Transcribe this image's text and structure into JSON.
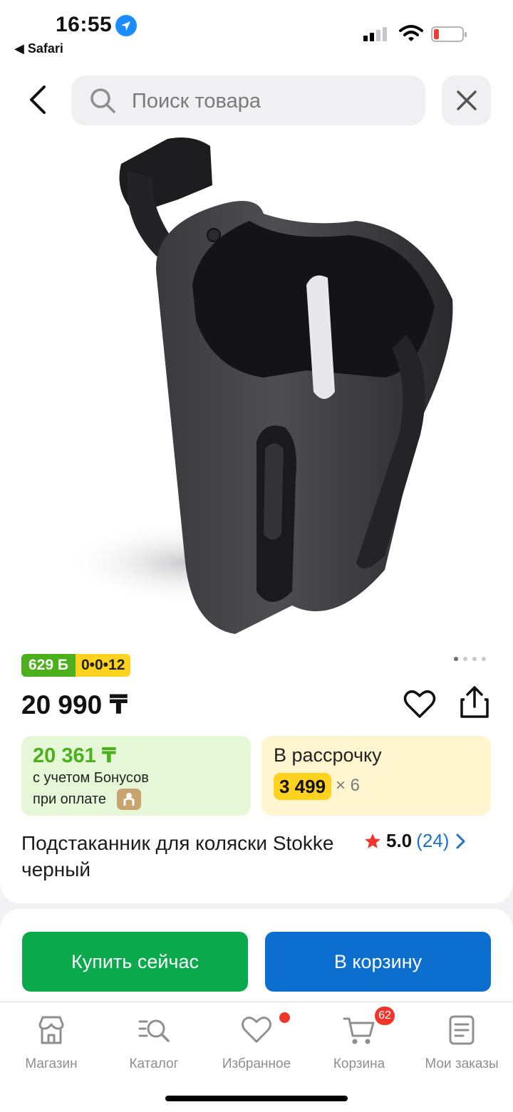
{
  "status_bar": {
    "time": "16:55",
    "back_app": "◀ Safari"
  },
  "header": {
    "search_placeholder": "Поиск товара"
  },
  "product": {
    "bonus_badge": "629 Б",
    "installment_badge": "0•0•12",
    "price": "20 990 ₸",
    "bonus_box": {
      "amount": "20 361 ₸",
      "line1": "с учетом Бонусов",
      "line2": "при оплате"
    },
    "installment_box": {
      "title": "В рассрочку",
      "amount": "3 499",
      "multiplier": "× 6"
    },
    "title": "Подстаканник для коляски Stokke черный",
    "rating": {
      "value": "5.0",
      "count": "(24)"
    },
    "gallery_dots": 4
  },
  "actions": {
    "buy_now": "Купить сейчас",
    "add_to_cart": "В корзину"
  },
  "tabbar": {
    "items": [
      {
        "label": "Магазин",
        "icon": "shop-icon"
      },
      {
        "label": "Каталог",
        "icon": "catalog-search-icon"
      },
      {
        "label": "Избранное",
        "icon": "heart-icon"
      },
      {
        "label": "Корзина",
        "icon": "cart-icon",
        "badge": "62"
      },
      {
        "label": "Мои заказы",
        "icon": "orders-icon"
      }
    ]
  },
  "colors": {
    "green": "#0aaa4c",
    "blue": "#0c6fd0",
    "bonus_green": "#4caf1c",
    "yellow": "#ffd21f",
    "red": "#f0362a"
  }
}
